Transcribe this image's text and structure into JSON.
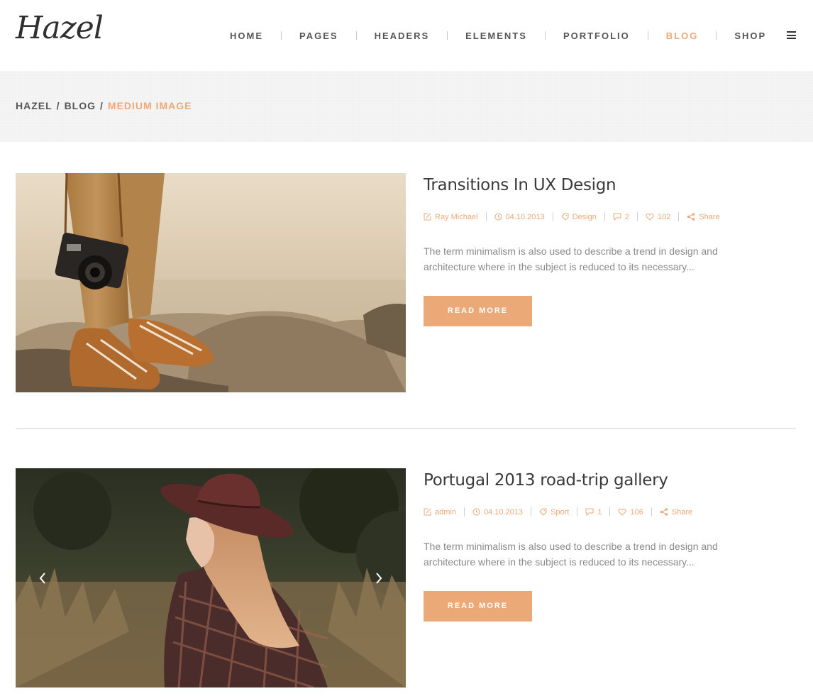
{
  "brand": {
    "logo_text": "Hazel",
    "accent_color": "#eba977"
  },
  "nav": {
    "items": [
      {
        "label": "HOME",
        "active": false
      },
      {
        "label": "PAGES",
        "active": false
      },
      {
        "label": "HEADERS",
        "active": false
      },
      {
        "label": "ELEMENTS",
        "active": false
      },
      {
        "label": "PORTFOLIO",
        "active": false
      },
      {
        "label": "BLOG",
        "active": true
      },
      {
        "label": "SHOP",
        "active": false
      }
    ],
    "menu_icon": "hamburger-icon"
  },
  "breadcrumb": {
    "home": "HAZEL",
    "sep": "/",
    "section": "BLOG",
    "current": "MEDIUM IMAGE"
  },
  "posts": [
    {
      "title": "Transitions In UX Design",
      "author": "Ray Michael",
      "date": "04.10.2013",
      "category": "Design",
      "comments": "2",
      "likes": "102",
      "share": "Share",
      "excerpt": "The term minimalism is also used to describe a trend in design and architecture where in the subject is reduced to its necessary...",
      "read_more": "READ MORE",
      "image": "photo-legs-camera-rocks"
    },
    {
      "title": "Portugal 2013 road-trip gallery",
      "author": "admin",
      "date": "04.10.2013",
      "category": "Sport",
      "comments": "1",
      "likes": "106",
      "share": "Share",
      "excerpt": "The term minimalism is also used to describe a trend in design and architecture where in the subject is reduced to its necessary...",
      "read_more": "READ MORE",
      "image": "photo-woman-hat-field",
      "gallery_prev_icon": "chevron-left-icon",
      "gallery_next_icon": "chevron-right-icon"
    }
  ]
}
